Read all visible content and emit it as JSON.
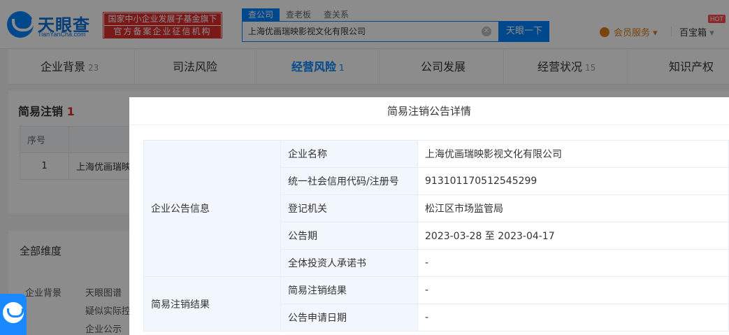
{
  "header": {
    "logo_text": "天眼查",
    "logo_sub": "TianYanCha.com",
    "badge_line1": "国家中小企业发展子基金旗下",
    "badge_line2": "官方备案企业征信机构",
    "search_tabs": [
      "查公司",
      "查老板",
      "查关系"
    ],
    "search_value": "上海优画瑞映影视文化有限公司",
    "search_button": "天眼一下",
    "member_label": "会员服务",
    "toolbox_label": "百宝箱",
    "hot_badge": "HOT"
  },
  "nav": {
    "items": [
      {
        "label": "企业背景",
        "count": "23"
      },
      {
        "label": "司法风险",
        "count": ""
      },
      {
        "label": "经营风险",
        "count": "1"
      },
      {
        "label": "公司发展",
        "count": ""
      },
      {
        "label": "经营状况",
        "count": "15"
      },
      {
        "label": "知识产权",
        "count": ""
      }
    ]
  },
  "background": {
    "section_title": "简易注销",
    "section_count": "1",
    "table_header": "序号",
    "row_index": "1",
    "row_company": "上海优画瑞映影",
    "all_dimensions": "全部维度",
    "dim_category": "企业背景",
    "dim_items": [
      "天眼图谱",
      "疑似实际控",
      "企业公示"
    ]
  },
  "modal": {
    "title": "简易注销公告详情",
    "group1": "企业公告信息",
    "group2": "简易注销结果",
    "rows": [
      {
        "key": "企业名称",
        "value": "上海优画瑞映影视文化有限公司"
      },
      {
        "key": "统一社会信用代码/注册号",
        "value": "913101170512545299"
      },
      {
        "key": "登记机关",
        "value": "松江区市场监管局"
      },
      {
        "key": "公告期",
        "value": "2023-03-28 至 2023-04-17"
      },
      {
        "key": "全体投资人承诺书",
        "value": "-"
      },
      {
        "key": "简易注销结果",
        "value": "-"
      },
      {
        "key": "公告申请日期",
        "value": "-"
      }
    ]
  }
}
